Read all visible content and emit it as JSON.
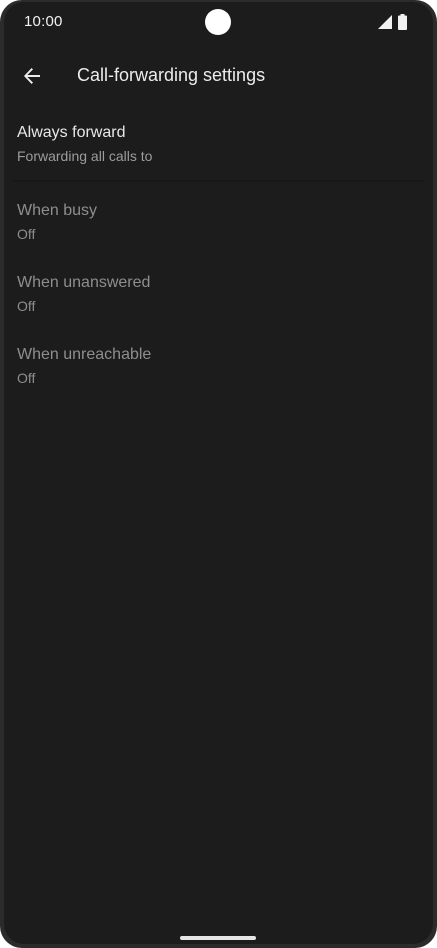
{
  "status_bar": {
    "time": "10:00"
  },
  "app_bar": {
    "back_icon": "arrow-back-icon",
    "title": "Call-forwarding settings"
  },
  "settings": [
    {
      "title": "Always forward",
      "summary": "Forwarding all calls to",
      "enabled": true
    },
    {
      "title": "When busy",
      "summary": "Off",
      "enabled": false
    },
    {
      "title": "When unanswered",
      "summary": "Off",
      "enabled": false
    },
    {
      "title": "When unreachable",
      "summary": "Off",
      "enabled": false
    }
  ],
  "colors": {
    "background": "#1c1c1c",
    "frame": "#2b2b2b",
    "primary_text": "#e8e8e8",
    "secondary_text": "#9c9c9c",
    "disabled_text": "#8e8e8e"
  }
}
